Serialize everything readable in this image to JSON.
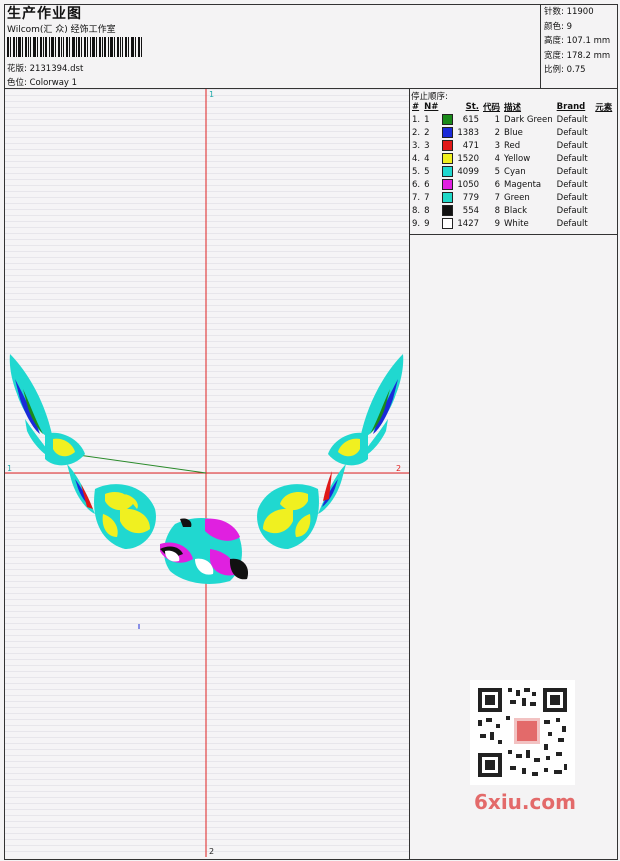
{
  "header": {
    "title": "生产作业图",
    "studio": "Wilcom(汇 众) 经饰工作室",
    "design_label": "花版:",
    "design_value": "2131394.dst",
    "colorway_label": "色位:",
    "colorway_value": "Colorway 1"
  },
  "stats": {
    "stitches_label": "针数:",
    "stitches_value": "11900",
    "colors_label": "颜色:",
    "colors_value": "9",
    "height_label": "高度:",
    "height_value": "107.1 mm",
    "width_label": "宽度:",
    "width_value": "178.2 mm",
    "ratio_label": "比例:",
    "ratio_value": "0.75"
  },
  "stop_sequence": {
    "title": "停止顺序:",
    "headers": [
      "#",
      "N#",
      "St.",
      "代码",
      "描述",
      "Brand",
      "元素"
    ],
    "rows": [
      {
        "idx": "1.",
        "n": "1",
        "color": "#1a8a1a",
        "st": "615",
        "code": "1",
        "desc": "Dark Green",
        "brand": "Default"
      },
      {
        "idx": "2.",
        "n": "2",
        "color": "#1a2ad8",
        "st": "1383",
        "code": "2",
        "desc": "Blue",
        "brand": "Default"
      },
      {
        "idx": "3.",
        "n": "3",
        "color": "#e01818",
        "st": "471",
        "code": "3",
        "desc": "Red",
        "brand": "Default"
      },
      {
        "idx": "4.",
        "n": "4",
        "color": "#f0f020",
        "st": "1520",
        "code": "4",
        "desc": "Yellow",
        "brand": "Default"
      },
      {
        "idx": "5.",
        "n": "5",
        "color": "#20d8d0",
        "st": "4099",
        "code": "5",
        "desc": "Cyan",
        "brand": "Default"
      },
      {
        "idx": "6.",
        "n": "6",
        "color": "#e020e0",
        "st": "1050",
        "code": "6",
        "desc": "Magenta",
        "brand": "Default"
      },
      {
        "idx": "7.",
        "n": "7",
        "color": "#20d8c8",
        "st": "779",
        "code": "7",
        "desc": "Green",
        "brand": "Default"
      },
      {
        "idx": "8.",
        "n": "8",
        "color": "#111111",
        "st": "554",
        "code": "8",
        "desc": "Black",
        "brand": "Default"
      },
      {
        "idx": "9.",
        "n": "9",
        "color": "#ffffff",
        "st": "1427",
        "code": "9",
        "desc": "White",
        "brand": "Default"
      }
    ]
  },
  "canvas": {
    "axis_top": "1",
    "axis_bottom": "2",
    "axis_left": "1",
    "axis_right": "2"
  },
  "watermark": "6xiu.com"
}
